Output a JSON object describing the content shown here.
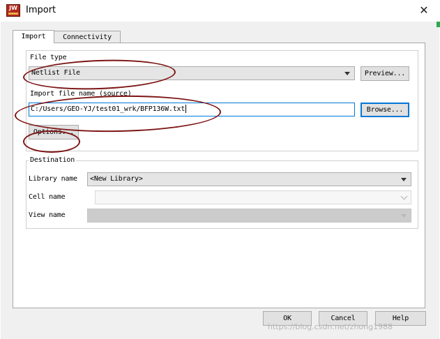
{
  "window": {
    "title": "Import",
    "close_glyph": "✕",
    "app_icon_text": "JW"
  },
  "tabs": [
    {
      "label": "Import",
      "active": true
    },
    {
      "label": "Connectivity",
      "active": false
    }
  ],
  "file_type": {
    "legend": "File type",
    "selected": "Netlist File",
    "preview_label": "Preview..."
  },
  "import_file": {
    "legend": "Import file name (source)",
    "value": "C:/Users/GEO-YJ/test01_wrk/BFP136W.txt",
    "browse_label": "Browse...",
    "options_label": "Options..."
  },
  "destination": {
    "legend": "Destination",
    "library_label": "Library name",
    "library_value": "<New Library>",
    "cell_label": "Cell name",
    "cell_value": "",
    "view_label": "View name",
    "view_value": ""
  },
  "buttons": {
    "ok": "OK",
    "cancel": "Cancel",
    "help": "Help"
  },
  "watermark": "https://blog.csdn.net/zhong1988",
  "colors": {
    "annotation": "#7d1515",
    "focus": "#0078d7",
    "app_icon": "#b22a1c"
  },
  "icons": {
    "close": "close-icon",
    "app": "app-logo-icon",
    "dropdown": "chevron-down-icon"
  }
}
